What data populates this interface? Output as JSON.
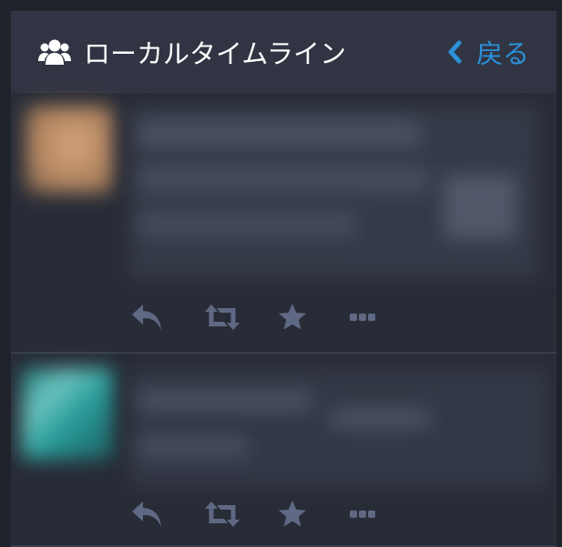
{
  "header": {
    "title": "ローカルタイムライン",
    "back_label": "戻る"
  },
  "icons": {
    "column": "users-icon",
    "back": "chevron-left-icon",
    "reply": "reply-icon",
    "boost": "retweet-icon",
    "favourite": "star-icon",
    "more": "ellipsis-icon"
  },
  "colors": {
    "background": "#282c37",
    "header": "#313543",
    "accent": "#2b90d9",
    "action_icon": "#606984",
    "text": "#ffffff"
  }
}
